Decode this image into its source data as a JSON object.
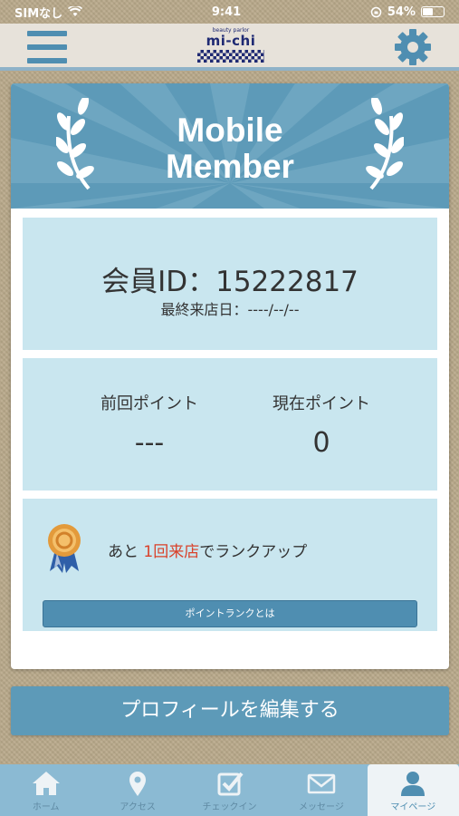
{
  "status_bar": {
    "carrier": "SIMなし",
    "time": "9:41",
    "battery": "54%",
    "battery_level": 0.54
  },
  "header": {
    "menu_icon": "hamburger-menu-icon",
    "logo_small": "beauty parlor",
    "logo_name": "mi-chi",
    "settings_icon": "gear-icon",
    "accent_color": "#4f8eb1"
  },
  "banner": {
    "title_line1": "Mobile",
    "title_line2": "Member",
    "color": "#5d9ab8"
  },
  "member": {
    "id_label": "会員ID：",
    "id_value": "15222817",
    "last_visit": "最終来店日：----/--/--"
  },
  "points": {
    "previous_label": "前回ポイント",
    "previous_value": "---",
    "current_label": "現在ポイント",
    "current_value": "0"
  },
  "rank": {
    "text_before": "あと",
    "highlight": "1回来店",
    "text_after": "でランクアップ",
    "highlight_color": "#d9412a",
    "button_label": "ポイントランクとは"
  },
  "profile_button": "プロフィールを編集する",
  "tabs": [
    {
      "label": "ホーム",
      "icon": "home-icon"
    },
    {
      "label": "アクセス",
      "icon": "location-pin-icon"
    },
    {
      "label": "チェックイン",
      "icon": "checkbox-icon"
    },
    {
      "label": "メッセージ",
      "icon": "mail-icon"
    },
    {
      "label": "マイページ",
      "icon": "user-icon",
      "active": true
    }
  ]
}
